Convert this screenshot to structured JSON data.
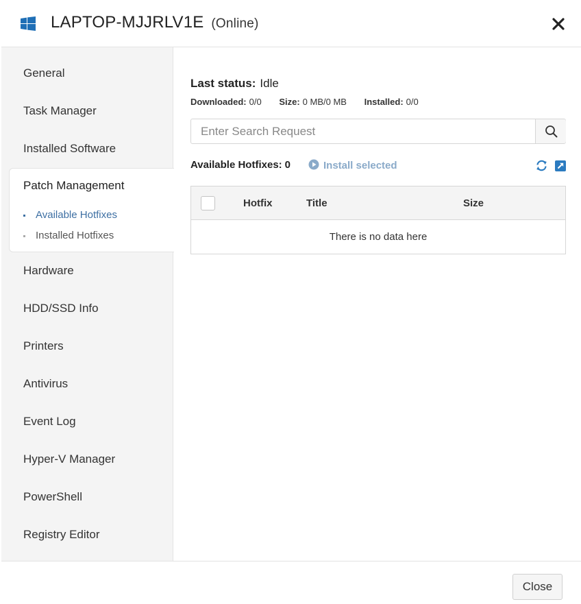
{
  "window": {
    "device_name": "LAPTOP-MJJRLV1E",
    "status": "(Online)",
    "icon": "windows-logo-icon",
    "close_icon": "close-icon"
  },
  "sidebar": {
    "items": [
      {
        "label": "General"
      },
      {
        "label": "Task Manager"
      },
      {
        "label": "Installed Software"
      },
      {
        "label": "Patch Management",
        "active": true
      },
      {
        "label": "Hardware"
      },
      {
        "label": "HDD/SSD Info"
      },
      {
        "label": "Printers"
      },
      {
        "label": "Antivirus"
      },
      {
        "label": "Event Log"
      },
      {
        "label": "Hyper-V Manager"
      },
      {
        "label": "PowerShell"
      },
      {
        "label": "Registry Editor"
      }
    ],
    "sub_items": [
      {
        "label": "Available Hotfixes",
        "active": true
      },
      {
        "label": "Installed Hotfixes"
      }
    ]
  },
  "main": {
    "last_status_label": "Last status:",
    "last_status_value": "Idle",
    "stats": {
      "downloaded_label": "Downloaded:",
      "downloaded_value": "0/0",
      "size_label": "Size:",
      "size_value": "0 MB/0 MB",
      "installed_label": "Installed:",
      "installed_value": "0/0"
    },
    "search": {
      "placeholder": "Enter Search Request",
      "value": "",
      "icon": "search-icon"
    },
    "available_label": "Available Hotfixes:",
    "available_count": "0",
    "install_selected_label": "Install selected",
    "table": {
      "columns": [
        "Hotfix",
        "Title",
        "Size"
      ],
      "empty_text": "There is no data here"
    }
  },
  "footer": {
    "close_label": "Close"
  },
  "colors": {
    "accent": "#3d6fa3",
    "windows_logo": "#1f6fb6",
    "install_selected": "#8aaac9",
    "icon_blue": "#2b7bc0"
  }
}
